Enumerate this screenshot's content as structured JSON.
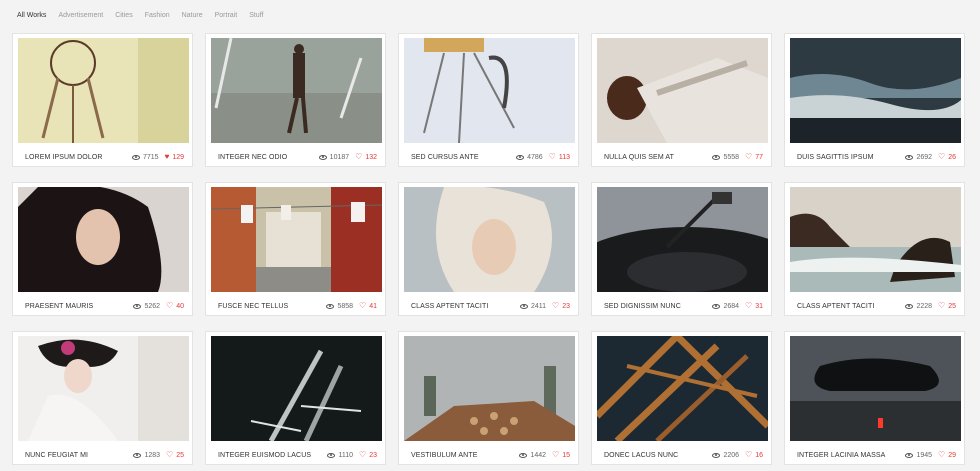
{
  "filters": [
    "All Works",
    "Advertisement",
    "Cities",
    "Fashion",
    "Nature",
    "Portrait",
    "Stuff"
  ],
  "active_filter": "All Works",
  "colors": {
    "accent_like": "#e23838",
    "background": "#f3f3f3",
    "card": "#ffffff"
  },
  "items": [
    {
      "title": "LOREM IPSUM DOLOR",
      "views": "7715",
      "likes": "129",
      "liked": true,
      "image": "dreamcatcher"
    },
    {
      "title": "INTEGER NEC ODIO",
      "views": "10187",
      "likes": "132",
      "liked": false,
      "image": "man-walking-street"
    },
    {
      "title": "SED CURSUS ANTE",
      "views": "4786",
      "likes": "113",
      "liked": false,
      "image": "camera-tripod"
    },
    {
      "title": "NULLA QUIS SEM AT",
      "views": "5558",
      "likes": "77",
      "liked": false,
      "image": "fashion-model-pose"
    },
    {
      "title": "DUIS SAGITTIS IPSUM",
      "views": "2692",
      "likes": "26",
      "liked": false,
      "image": "ocean-waves"
    },
    {
      "title": "PRAESENT MAURIS",
      "views": "5262",
      "likes": "40",
      "liked": false,
      "image": "woman-dark-hair"
    },
    {
      "title": "FUSCE NEC TELLUS",
      "views": "5858",
      "likes": "41",
      "liked": false,
      "image": "alley-laundry"
    },
    {
      "title": "CLASS APTENT TACITI",
      "views": "2411",
      "likes": "23",
      "liked": false,
      "image": "blonde-hair"
    },
    {
      "title": "SED DIGNISSIM NUNC",
      "views": "2684",
      "likes": "31",
      "liked": false,
      "image": "record-player"
    },
    {
      "title": "CLASS APTENT TACITI",
      "views": "2228",
      "likes": "25",
      "liked": false,
      "image": "sea-rocks"
    },
    {
      "title": "NUNC FEUGIAT MI",
      "views": "1283",
      "likes": "25",
      "liked": false,
      "image": "fashion-headdress"
    },
    {
      "title": "INTEGER EUISMOD LACUS",
      "views": "1110",
      "likes": "23",
      "liked": false,
      "image": "forks"
    },
    {
      "title": "VESTIBULUM ANTE",
      "views": "1442",
      "likes": "15",
      "liked": false,
      "image": "log-pile"
    },
    {
      "title": "DONEC LACUS NUNC",
      "views": "2206",
      "likes": "16",
      "liked": false,
      "image": "steel-structure"
    },
    {
      "title": "INTEGER LACINIA MASSA",
      "views": "1945",
      "likes": "29",
      "liked": false,
      "image": "game-controller"
    }
  ]
}
